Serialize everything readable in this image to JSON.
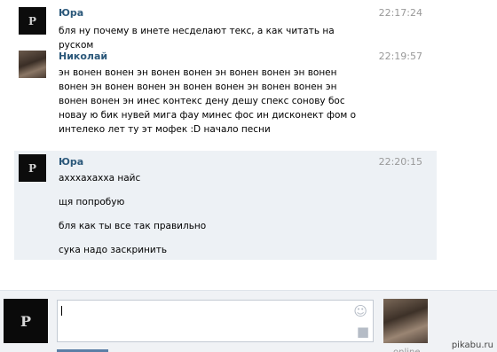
{
  "messages": [
    {
      "author": "Юра",
      "time": "22:17:24",
      "lines": [
        "бля ну почему в инете несделают текс, а как читать на руском"
      ]
    },
    {
      "author": "Николай",
      "time": "22:19:57",
      "lines": [
        "эн вонен вонен эн вонен вонен эн вонен вонен эн вонен вонен эн вонен вонен эн вонен вонен эн вонен вонен эн вонен вонен эн инес контекс дену дешу спекс сонову бос новау ю бик нувей мига фау минес фос ин дисконект фом о интелеко лет ту эт мофек :D начало песни"
      ]
    },
    {
      "author": "Юра",
      "time": "22:20:15",
      "lines": [
        "ахххахахха найс",
        "щя попробую",
        "бля как ты все так правильно",
        "сука надо заскринить"
      ]
    }
  ],
  "avatar_glyph": "P",
  "composer": {
    "placeholder": "",
    "status": "online"
  },
  "watermark": "pikabu.ru",
  "icons": {
    "smile": "smile-icon",
    "camera": "camera-icon"
  },
  "colors": {
    "author": "#2b587a",
    "highlight": "#edf1f5",
    "time": "#999999"
  }
}
